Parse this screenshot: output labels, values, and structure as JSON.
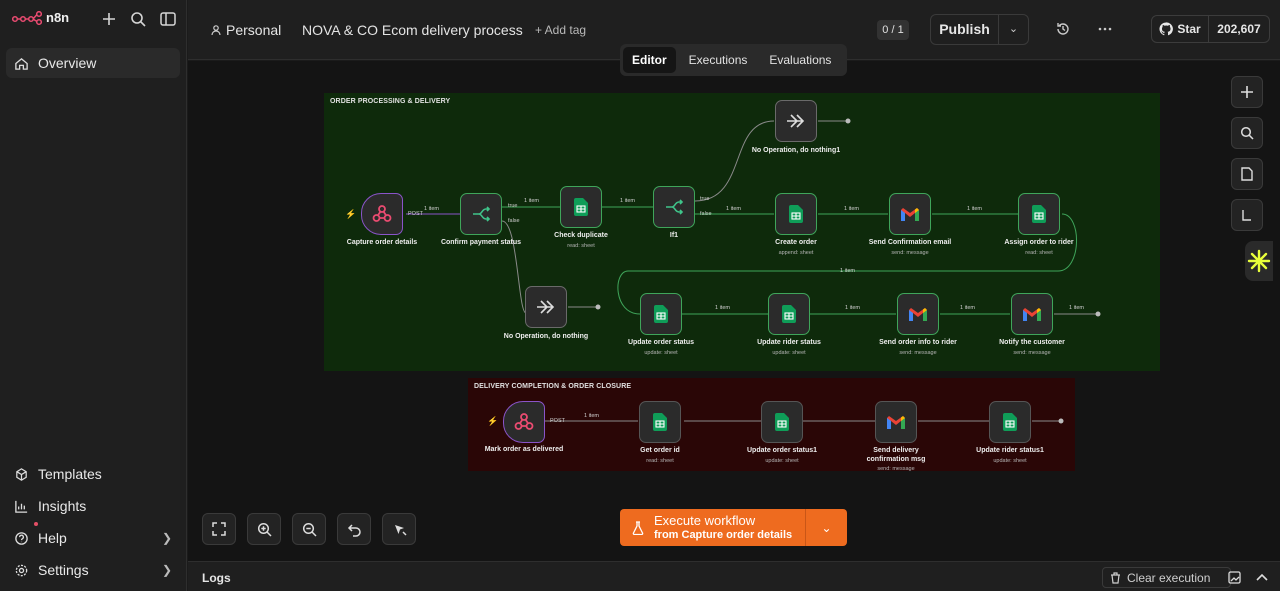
{
  "app": {
    "name": "n8n"
  },
  "sidebar": {
    "overview": "Overview",
    "templates": "Templates",
    "insights": "Insights",
    "help": "Help",
    "settings": "Settings"
  },
  "header": {
    "project": "Personal",
    "workflow_name": "NOVA & CO Ecom delivery process",
    "add_tag": "+ Add tag",
    "counter": "0 / 1",
    "publish": "Publish",
    "github_star": "Star",
    "github_count": "202,607"
  },
  "tabs": [
    "Editor",
    "Executions",
    "Evaluations"
  ],
  "colors": {
    "accent": "#ee6b1f",
    "group1": "#0e2a0b",
    "group2": "#2a0606",
    "success": "#3fa55a"
  },
  "groups": {
    "order": "ORDER PROCESSING & DELIVERY",
    "closure": "DELIVERY COMPLETION & ORDER CLOSURE"
  },
  "nodes": {
    "capture": {
      "name": "Capture order details"
    },
    "confirm": {
      "name": "Confirm payment status"
    },
    "check": {
      "name": "Check duplicate",
      "sub": "read: sheet"
    },
    "if1": {
      "name": "If1"
    },
    "noop1": {
      "name": "No Operation, do nothing1"
    },
    "create": {
      "name": "Create order",
      "sub": "append: sheet"
    },
    "sendconf": {
      "name": "Send Confirmation email",
      "sub": "send: message"
    },
    "assign": {
      "name": "Assign order to rider",
      "sub": "read: sheet"
    },
    "noop": {
      "name": "No Operation, do nothing"
    },
    "updorder": {
      "name": "Update order status",
      "sub": "update: sheet"
    },
    "updrider": {
      "name": "Update rider status",
      "sub": "update: sheet"
    },
    "sendrider": {
      "name": "Send order info to rider",
      "sub": "send: message"
    },
    "notify": {
      "name": "Notify the customer",
      "sub": "send: message"
    },
    "mark": {
      "name": "Mark order as delivered"
    },
    "getid": {
      "name": "Get order id",
      "sub": "read: sheet"
    },
    "updorder1": {
      "name": "Update order status1",
      "sub": "update: sheet"
    },
    "senddel": {
      "name": "Send delivery confirmation msg",
      "sub": "send: message"
    },
    "updrider1": {
      "name": "Update rider status1",
      "sub": "update: sheet"
    }
  },
  "edge_labels": {
    "item": "1 item",
    "post": "POST",
    "true_lbl": "true",
    "false_lbl": "false"
  },
  "execute": {
    "title": "Execute workflow",
    "subtitle": "from Capture order details"
  },
  "logs": {
    "title": "Logs",
    "clear": "Clear execution"
  }
}
